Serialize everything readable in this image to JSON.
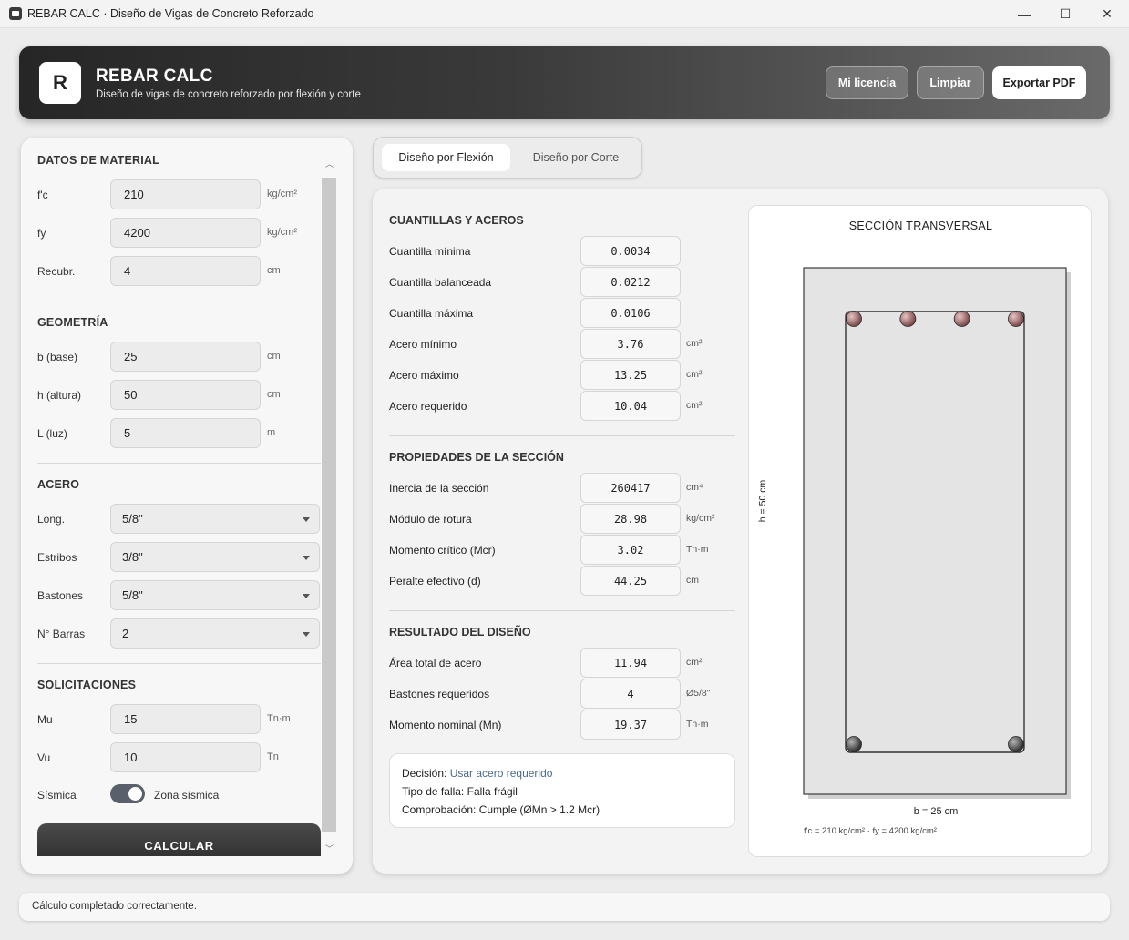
{
  "window": {
    "title": "REBAR CALC · Diseño de Vigas de Concreto Reforzado",
    "minimize": "—",
    "maximize": "☐",
    "close": "✕"
  },
  "header": {
    "logo_letter": "R",
    "title": "REBAR CALC",
    "subtitle": "Diseño de vigas de concreto reforzado por flexión y corte",
    "buttons": {
      "license": "Mi licencia",
      "clear": "Limpiar",
      "export": "Exportar PDF"
    }
  },
  "left": {
    "material": {
      "title": "DATOS DE MATERIAL",
      "fc": {
        "label": "f'c",
        "value": "210",
        "unit": "kg/cm²"
      },
      "fy": {
        "label": "fy",
        "value": "4200",
        "unit": "kg/cm²"
      },
      "cover": {
        "label": "Recubr.",
        "value": "4",
        "unit": "cm"
      }
    },
    "geometry": {
      "title": "GEOMETRÍA",
      "b": {
        "label": "b (base)",
        "value": "25",
        "unit": "cm"
      },
      "h": {
        "label": "h (altura)",
        "value": "50",
        "unit": "cm"
      },
      "L": {
        "label": "L (luz)",
        "value": "5",
        "unit": "m"
      }
    },
    "steel": {
      "title": "ACERO",
      "long": {
        "label": "Long.",
        "value": "5/8\""
      },
      "stirrups": {
        "label": "Estribos",
        "value": "3/8\""
      },
      "bars": {
        "label": "Bastones",
        "value": "5/8\""
      },
      "count": {
        "label": "N° Barras",
        "value": "2"
      }
    },
    "loads": {
      "title": "SOLICITACIONES",
      "mu": {
        "label": "Mu",
        "value": "15",
        "unit": "Tn·m"
      },
      "vu": {
        "label": "Vu",
        "value": "10",
        "unit": "Tn"
      },
      "seismic": {
        "label": "Sísmica",
        "toggle_label": "Zona sísmica",
        "on": true
      }
    },
    "calculate": "CALCULAR"
  },
  "tabs": {
    "flexion": "Diseño por Flexión",
    "shear": "Diseño por Corte"
  },
  "results": {
    "ratios": {
      "title": "CUANTILLAS Y ACEROS",
      "rows": [
        {
          "label": "Cuantilla mínima",
          "value": "0.0034",
          "unit": ""
        },
        {
          "label": "Cuantilla balanceada",
          "value": "0.0212",
          "unit": ""
        },
        {
          "label": "Cuantilla máxima",
          "value": "0.0106",
          "unit": ""
        },
        {
          "label": "Acero mínimo",
          "value": "3.76",
          "unit": "cm²"
        },
        {
          "label": "Acero máximo",
          "value": "13.25",
          "unit": "cm²"
        },
        {
          "label": "Acero requerido",
          "value": "10.04",
          "unit": "cm²"
        }
      ]
    },
    "properties": {
      "title": "PROPIEDADES DE LA SECCIÓN",
      "rows": [
        {
          "label": "Inercia de la sección",
          "value": "260417",
          "unit": "cm⁴"
        },
        {
          "label": "Módulo de rotura",
          "value": "28.98",
          "unit": "kg/cm²"
        },
        {
          "label": "Momento crítico (Mcr)",
          "value": "3.02",
          "unit": "Tn·m"
        },
        {
          "label": "Peralte efectivo (d)",
          "value": "44.25",
          "unit": "cm"
        }
      ]
    },
    "design": {
      "title": "RESULTADO DEL DISEÑO",
      "rows": [
        {
          "label": "Área total de acero",
          "value": "11.94",
          "unit": "cm²"
        },
        {
          "label": "Bastones requeridos",
          "value": "4",
          "unit": "Ø5/8\""
        },
        {
          "label": "Momento nominal (Mn)",
          "value": "19.37",
          "unit": "Tn·m"
        }
      ]
    },
    "decision": {
      "decision_label": "Decisión:",
      "decision_value": "Usar acero requerido",
      "failure_label": "Tipo de falla:",
      "failure_value": "Falla frágil",
      "check_label": "Comprobación:",
      "check_value": "Cumple (ØMn > 1.2 Mcr)"
    }
  },
  "section_view": {
    "title": "SECCIÓN TRANSVERSAL",
    "b_label": "b = 25 cm",
    "h_label": "h = 50 cm",
    "note": "f'c = 210 kg/cm² · fy = 4200 kg/cm²",
    "top_bars": 4,
    "bottom_bars": 2
  },
  "status": {
    "message": "Cálculo completado correctamente."
  }
}
